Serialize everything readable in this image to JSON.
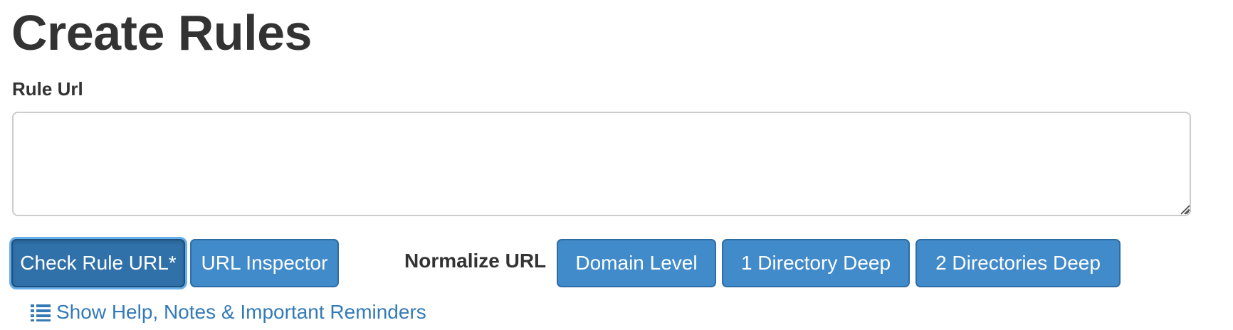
{
  "page": {
    "title": "Create Rules"
  },
  "rule_url": {
    "label": "Rule Url",
    "value": "",
    "placeholder": ""
  },
  "buttons": {
    "check_rule_url": "Check Rule URL*",
    "url_inspector": "URL Inspector",
    "normalize_label": "Normalize URL",
    "domain_level": "Domain Level",
    "one_directory_deep": "1 Directory Deep",
    "two_directories_deep": "2 Directories Deep"
  },
  "help": {
    "link_text": "Show Help, Notes & Important Reminders",
    "icon": "list-icon"
  },
  "colors": {
    "primary": "#428bca",
    "primary_border": "#2e6da4",
    "primary_active": "#3071a9",
    "link": "#337ab7",
    "text": "#333333"
  }
}
